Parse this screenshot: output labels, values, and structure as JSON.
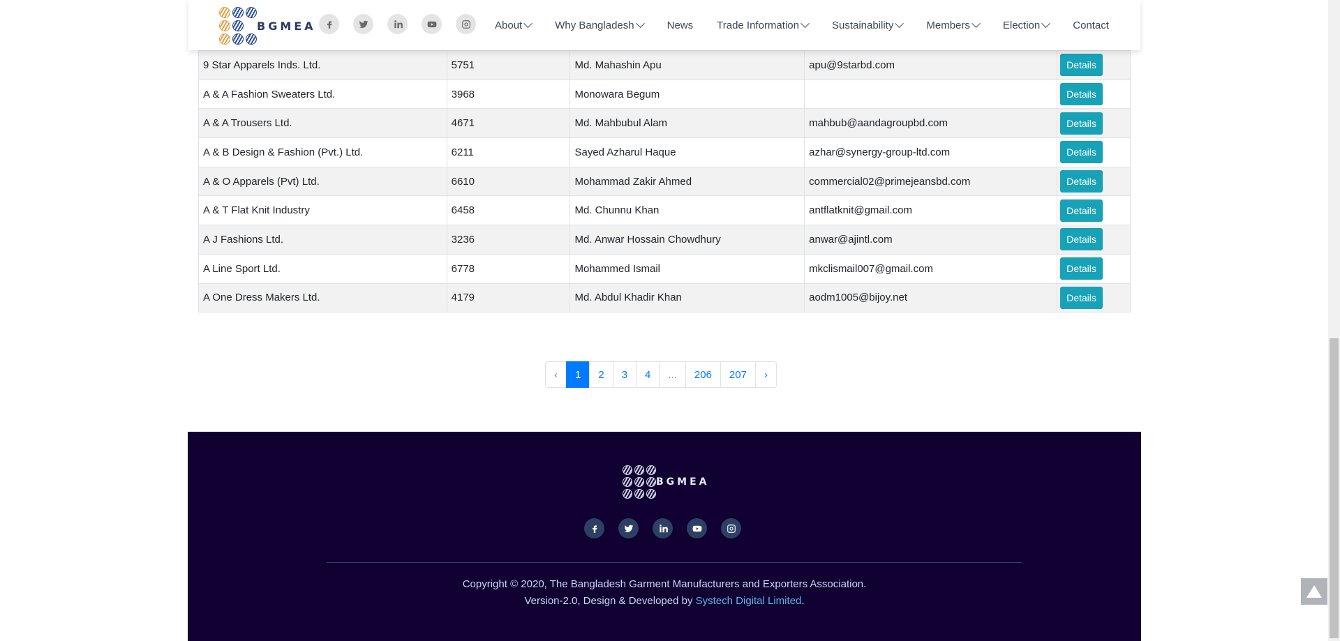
{
  "header": {
    "logo_text": "BGMEA",
    "social": [
      "facebook-icon",
      "twitter-icon",
      "linkedin-icon",
      "youtube-icon",
      "instagram-icon"
    ],
    "menu": [
      {
        "label": "About",
        "has_dropdown": true
      },
      {
        "label": "Why Bangladesh",
        "has_dropdown": true
      },
      {
        "label": "News",
        "has_dropdown": false
      },
      {
        "label": "Trade Information",
        "has_dropdown": true
      },
      {
        "label": "Sustainability",
        "has_dropdown": true
      },
      {
        "label": "Members",
        "has_dropdown": true
      },
      {
        "label": "Election",
        "has_dropdown": true
      },
      {
        "label": "Contact",
        "has_dropdown": false
      }
    ]
  },
  "table": {
    "details_label": "Details",
    "rows": [
      {
        "company": "9 Star Apparels Inds. Ltd.",
        "reg_no": "5751",
        "contact": "Md. Mahashin Apu",
        "email": "apu@9starbd.com"
      },
      {
        "company": "A & A Fashion Sweaters Ltd.",
        "reg_no": "3968",
        "contact": "Monowara Begum",
        "email": ""
      },
      {
        "company": "A & A Trousers Ltd.",
        "reg_no": "4671",
        "contact": "Md. Mahbubul Alam",
        "email": "mahbub@aandagroupbd.com"
      },
      {
        "company": "A & B Design & Fashion (Pvt.) Ltd.",
        "reg_no": "6211",
        "contact": "Sayed Azharul Haque",
        "email": "azhar@synergy-group-ltd.com"
      },
      {
        "company": "A & O Apparels (Pvt) Ltd.",
        "reg_no": "6610",
        "contact": "Mohammad Zakir Ahmed",
        "email": "commercial02@primejeansbd.com"
      },
      {
        "company": "A & T Flat Knit Industry",
        "reg_no": "6458",
        "contact": "Md. Chunnu Khan",
        "email": "antflatknit@gmail.com"
      },
      {
        "company": "A J Fashions Ltd.",
        "reg_no": "3236",
        "contact": "Md. Anwar Hossain Chowdhury",
        "email": "anwar@ajintl.com"
      },
      {
        "company": "A Line Sport Ltd.",
        "reg_no": "6778",
        "contact": "Mohammed Ismail",
        "email": "mkclismail007@gmail.com"
      },
      {
        "company": "A One Dress Makers Ltd.",
        "reg_no": "4179",
        "contact": "Md. Abdul Khadir Khan",
        "email": "aodm1005@bijoy.net"
      }
    ]
  },
  "pagination": {
    "prev": "‹",
    "pages": [
      "1",
      "2",
      "3",
      "4",
      "...",
      "206",
      "207"
    ],
    "active": "1",
    "next": "›"
  },
  "footer": {
    "logo_text": "BGMEA",
    "social": [
      "facebook-icon",
      "twitter-icon",
      "linkedin-icon",
      "youtube-icon",
      "instagram-icon"
    ],
    "copyright": "Copyright © 2020, The Bangladesh Garment Manufacturers and Exporters Association.",
    "version_prefix": "Version-2.0, Design & Developed by ",
    "developer": "Systech Digital Limited",
    "version_suffix": "."
  },
  "colors": {
    "accent": "#17a2b8",
    "link": "#007bff",
    "footer_bg": "#110032",
    "nav_text": "#3b4557"
  }
}
